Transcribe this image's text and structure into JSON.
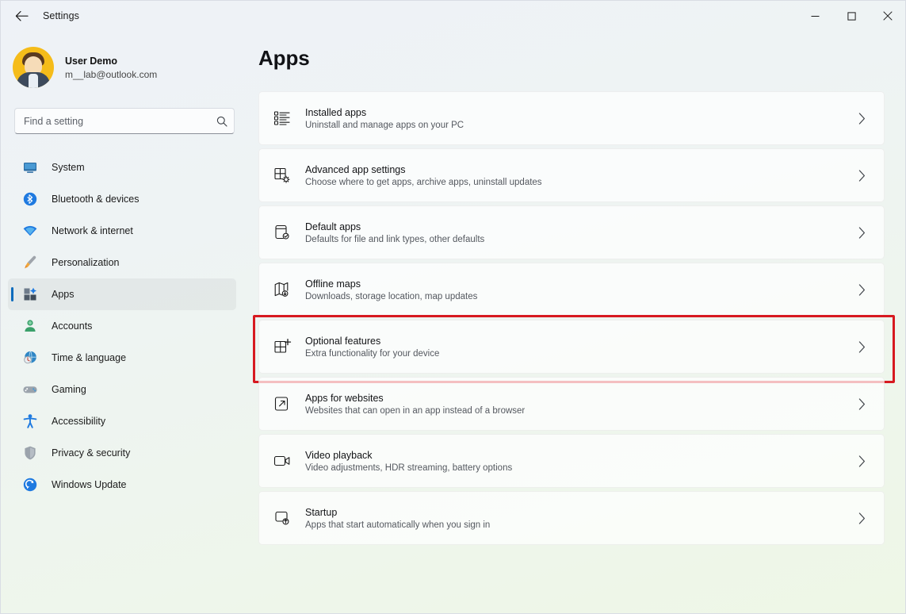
{
  "window": {
    "app_title": "Settings",
    "back_icon": "back-arrow-icon",
    "controls": {
      "minimize": "minimize-icon",
      "maximize": "maximize-icon",
      "close": "close-icon"
    }
  },
  "sidebar": {
    "account": {
      "name": "User Demo",
      "email": "m__lab@outlook.com",
      "avatar_icon": "user-avatar"
    },
    "search": {
      "placeholder": "Find a setting",
      "value": "",
      "icon": "search-icon"
    },
    "items": [
      {
        "label": "System",
        "icon": "monitor-icon",
        "selected": false
      },
      {
        "label": "Bluetooth & devices",
        "icon": "bluetooth-icon",
        "selected": false
      },
      {
        "label": "Network & internet",
        "icon": "wifi-icon",
        "selected": false
      },
      {
        "label": "Personalization",
        "icon": "paintbrush-icon",
        "selected": false
      },
      {
        "label": "Apps",
        "icon": "apps-grid-icon",
        "selected": true
      },
      {
        "label": "Accounts",
        "icon": "person-icon",
        "selected": false
      },
      {
        "label": "Time & language",
        "icon": "clock-globe-icon",
        "selected": false
      },
      {
        "label": "Gaming",
        "icon": "gamepad-icon",
        "selected": false
      },
      {
        "label": "Accessibility",
        "icon": "accessibility-person-icon",
        "selected": false
      },
      {
        "label": "Privacy & security",
        "icon": "shield-icon",
        "selected": false
      },
      {
        "label": "Windows Update",
        "icon": "update-refresh-icon",
        "selected": false
      }
    ]
  },
  "main": {
    "page_title": "Apps",
    "rows": [
      {
        "title": "Installed apps",
        "subtitle": "Uninstall and manage apps on your PC",
        "icon": "list-apps-icon",
        "highlighted": false
      },
      {
        "title": "Advanced app settings",
        "subtitle": "Choose where to get apps, archive apps, uninstall updates",
        "icon": "window-gear-icon",
        "highlighted": false
      },
      {
        "title": "Default apps",
        "subtitle": "Defaults for file and link types, other defaults",
        "icon": "app-check-icon",
        "highlighted": false
      },
      {
        "title": "Offline maps",
        "subtitle": "Downloads, storage location, map updates",
        "icon": "map-download-icon",
        "highlighted": false
      },
      {
        "title": "Optional features",
        "subtitle": "Extra functionality for your device",
        "icon": "grid-plus-icon",
        "highlighted": true
      },
      {
        "title": "Apps for websites",
        "subtitle": "Websites that can open in an app instead of a browser",
        "icon": "external-link-icon",
        "highlighted": false
      },
      {
        "title": "Video playback",
        "subtitle": "Video adjustments, HDR streaming, battery options",
        "icon": "video-camera-icon",
        "highlighted": false
      },
      {
        "title": "Startup",
        "subtitle": "Apps that start automatically when you sign in",
        "icon": "startup-power-icon",
        "highlighted": false
      }
    ],
    "chevron_icon": "chevron-right-icon"
  },
  "colors": {
    "accent": "#0f6cbd",
    "annotation": "#d71920",
    "avatar_bg": "#f5bc1a"
  }
}
